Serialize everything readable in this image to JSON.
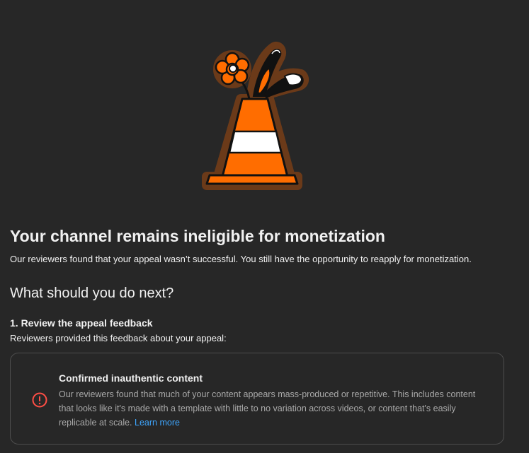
{
  "illustration": {
    "icon": "traffic-cone-flower-icon",
    "colors": {
      "cone": "#ff6d00",
      "stripe": "#ffffff",
      "outline": "#111111",
      "halo": "#6b3a19"
    }
  },
  "header": {
    "title": "Your channel remains ineligible for monetization",
    "subtitle": "Our reviewers found that your appeal wasn’t successful. You still have the opportunity to reapply for monetization."
  },
  "next_steps": {
    "heading": "What should you do next?",
    "step1": {
      "heading": "1. Review the appeal feedback",
      "description": "Reviewers provided this feedback about your appeal:"
    }
  },
  "feedback_card": {
    "icon": "alert-circle-icon",
    "icon_color": "#ff4e45",
    "title": "Confirmed inauthentic content",
    "body": "Our reviewers found that much of your content appears mass-produced or repetitive. This includes content that looks like it's made with a template with little to no variation across videos, or content that's easily replicable at scale.",
    "link_text": "Learn more",
    "link_color": "#3ea6ff"
  },
  "colors": {
    "background": "#272727",
    "text_primary": "#f1f1f1",
    "text_secondary": "#aaaaaa",
    "card_border": "#4d4d4d"
  }
}
